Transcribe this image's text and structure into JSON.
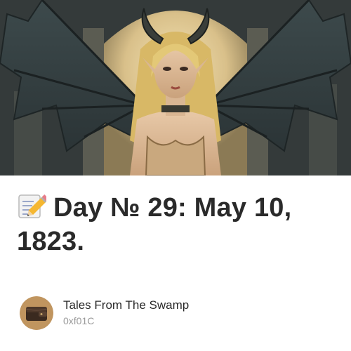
{
  "post": {
    "cover_image": "demon-woman-with-wings-illustration",
    "title_icon": "memo-pencil-icon",
    "title": "Day № 29: May 10, 1823."
  },
  "author": {
    "name": "Tales From The Swamp",
    "handle": "0xf01C",
    "avatar": "wallet-avatar"
  }
}
